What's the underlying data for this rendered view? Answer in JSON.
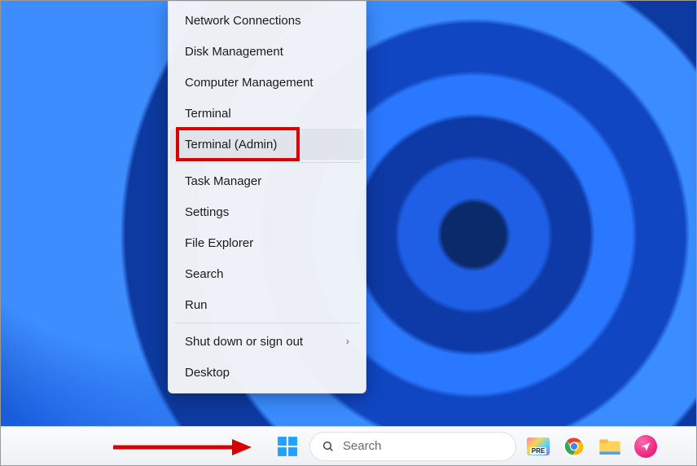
{
  "context_menu": {
    "items": [
      {
        "label": "Network Connections",
        "submenu": false,
        "sep_after": false
      },
      {
        "label": "Disk Management",
        "submenu": false,
        "sep_after": false
      },
      {
        "label": "Computer Management",
        "submenu": false,
        "sep_after": false
      },
      {
        "label": "Terminal",
        "submenu": false,
        "sep_after": false
      },
      {
        "label": "Terminal (Admin)",
        "submenu": false,
        "sep_after": true,
        "highlighted": true,
        "hover": true
      },
      {
        "label": "Task Manager",
        "submenu": false,
        "sep_after": false
      },
      {
        "label": "Settings",
        "submenu": false,
        "sep_after": false
      },
      {
        "label": "File Explorer",
        "submenu": false,
        "sep_after": false
      },
      {
        "label": "Search",
        "submenu": false,
        "sep_after": false
      },
      {
        "label": "Run",
        "submenu": false,
        "sep_after": true
      },
      {
        "label": "Shut down or sign out",
        "submenu": true,
        "sep_after": false
      },
      {
        "label": "Desktop",
        "submenu": false,
        "sep_after": false
      }
    ]
  },
  "taskbar": {
    "search_placeholder": "Search",
    "pinned": [
      {
        "name": "copilot-preview",
        "bg": "linear-gradient(135deg,#ff7ab6,#ffd54a,#57d7ff,#8a6dff)",
        "text": "PRE",
        "shape": "square"
      },
      {
        "name": "chrome",
        "shape": "round"
      },
      {
        "name": "file-explorer-pinned",
        "shape": "square"
      },
      {
        "name": "app-pink",
        "shape": "round"
      }
    ]
  },
  "annotation": {
    "highlight_color": "#d80000",
    "arrow_color": "#d80000"
  }
}
